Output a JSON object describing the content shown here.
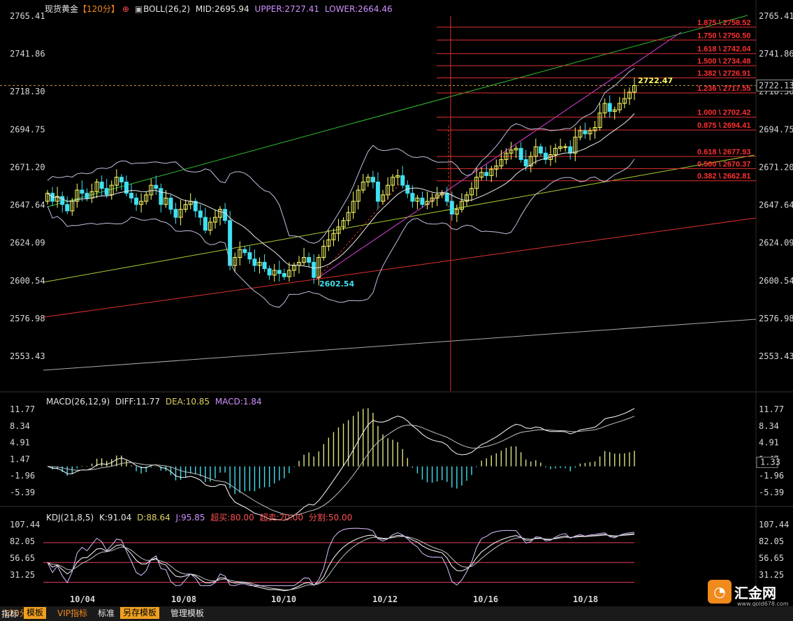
{
  "header": {
    "symbol": "现货黄金",
    "period": "【120分】",
    "period_icon": "circle-plus-icon",
    "boll_label": "BOLL(26,2)",
    "boll_mid": "MID:2695.94",
    "boll_upper": "UPPER:2727.41",
    "boll_lower": "LOWER:2664.46"
  },
  "macd_header": {
    "label": "MACD(26,12,9)",
    "diff": "DIFF:11.77",
    "dea": "DEA:10.85",
    "macd": "MACD:1.84"
  },
  "kdj_header": {
    "label": "KDJ(21,8,5)",
    "k": "K:91.04",
    "d": "D:88.64",
    "j": "J:95.85",
    "overbought": "超买:80.00",
    "oversold": "超卖:20.00",
    "split": "分割:50.00"
  },
  "annotations": {
    "high_label": "2722.47",
    "low_label": "2602.54",
    "current_price": "2722.13",
    "macd_current": "1.33"
  },
  "fib_levels": [
    {
      "label": "1.875 \\ 2758.52",
      "price": 2758.52
    },
    {
      "label": "1.750 \\ 2750.50",
      "price": 2750.5
    },
    {
      "label": "1.618 \\ 2742.04",
      "price": 2742.04
    },
    {
      "label": "1.500 \\ 2734.48",
      "price": 2734.48
    },
    {
      "label": "1.382 \\ 2726.91",
      "price": 2726.91
    },
    {
      "label": "1.236 \\ 2717.55",
      "price": 2717.55
    },
    {
      "label": "1.000 \\ 2702.42",
      "price": 2702.42
    },
    {
      "label": "0.875 \\ 2694.41",
      "price": 2694.41
    },
    {
      "label": "0.618 \\ 2677.93",
      "price": 2677.93
    },
    {
      "label": "0.500 \\ 2670.37",
      "price": 2670.37
    },
    {
      "label": "0.382 \\ 2662.81",
      "price": 2662.81
    }
  ],
  "chart_data": [
    {
      "type": "candlestick",
      "title": "现货黄金 120分",
      "ylim": [
        2541.0,
        2770.0
      ],
      "yticks": [
        "2765.41",
        "2741.86",
        "2718.30",
        "2694.75",
        "2671.20",
        "2647.64",
        "2624.09",
        "2600.54",
        "2576.98",
        "2553.43"
      ],
      "xticks": [
        "10/04",
        "10/08",
        "10/10",
        "10/12",
        "10/16",
        "10/18"
      ],
      "closes": [
        2655,
        2650,
        2653,
        2648,
        2644,
        2650,
        2657,
        2655,
        2652,
        2656,
        2662,
        2658,
        2654,
        2660,
        2665,
        2662,
        2655,
        2652,
        2648,
        2650,
        2654,
        2660,
        2658,
        2648,
        2652,
        2645,
        2640,
        2645,
        2648,
        2650,
        2644,
        2640,
        2632,
        2637,
        2640,
        2645,
        2638,
        2610,
        2615,
        2620,
        2618,
        2614,
        2610,
        2612,
        2608,
        2604,
        2607,
        2605,
        2603,
        2607,
        2610,
        2612,
        2615,
        2612,
        2602.54,
        2615,
        2622,
        2626,
        2630,
        2634,
        2638,
        2643,
        2650,
        2657,
        2662,
        2665,
        2662,
        2650,
        2654,
        2660,
        2665,
        2666,
        2660,
        2655,
        2650,
        2652,
        2648,
        2650,
        2652,
        2654,
        2655,
        2650,
        2642,
        2645,
        2650,
        2654,
        2658,
        2665,
        2668,
        2666,
        2670,
        2672,
        2676,
        2680,
        2682,
        2683,
        2676,
        2672,
        2678,
        2684,
        2680,
        2676,
        2679,
        2683,
        2684,
        2684,
        2680,
        2690,
        2694,
        2692,
        2694,
        2696,
        2705,
        2711,
        2706,
        2707,
        2711,
        2714,
        2718,
        2722.13
      ],
      "bollinger": {
        "mid": 2695.94,
        "upper": 2727.41,
        "lower": 2664.46
      },
      "fib_anchor": {
        "low": 2602.54,
        "high": 2722.47
      }
    },
    {
      "type": "bar",
      "title": "MACD(26,12,9)",
      "yticks": [
        "11.77",
        "8.34",
        "4.91",
        "1.47",
        "-1.96",
        "-5.39"
      ],
      "ylim": [
        -8.5,
        14
      ],
      "diff_last": 11.77,
      "dea_last": 10.85,
      "macd_last": 1.84
    },
    {
      "type": "line",
      "title": "KDJ(21,8,5)",
      "yticks": [
        "107.44",
        "82.05",
        "56.65",
        "31.25"
      ],
      "ylim": [
        15,
        110
      ],
      "levels": {
        "overbought": 80,
        "oversold": 20,
        "split": 50
      },
      "series": [
        {
          "name": "K",
          "last": 91.04
        },
        {
          "name": "D",
          "last": 88.64
        },
        {
          "name": "J",
          "last": 95.85
        }
      ]
    }
  ],
  "bottom_bar": {
    "period_label": "120分 ▲",
    "tabs": [
      "指标",
      "模板",
      "VIP指标",
      "标准",
      "另存模板",
      "管理模板"
    ]
  },
  "logo": {
    "text": "汇金网",
    "url": "www.gold678.com"
  },
  "colors": {
    "bull": "#ffff66",
    "bear": "#40e0f0",
    "fib": "#ff3030",
    "green_line": "#30c030",
    "magenta": "#e040e0",
    "red_line": "#e03030"
  }
}
